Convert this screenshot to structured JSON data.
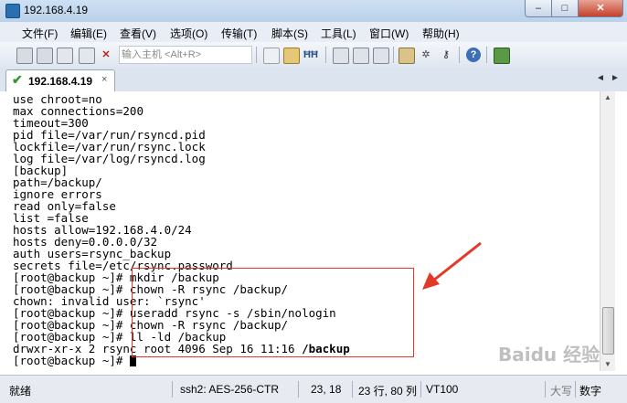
{
  "window": {
    "title": "192.168.4.19",
    "min": "–",
    "max": "□",
    "close": "✕"
  },
  "menubar": [
    "文件(F)",
    "编辑(E)",
    "查看(V)",
    "选项(O)",
    "传输(T)",
    "脚本(S)",
    "工具(L)",
    "窗口(W)",
    "帮助(H)"
  ],
  "toolbar": {
    "host_placeholder": "输入主机 <Alt+R>",
    "icons": [
      "connect-icon",
      "quick-connect-icon",
      "connect-tab-icon",
      "reconnect-icon",
      "disconnect-icon",
      "copy-icon",
      "paste-icon",
      "find-icon",
      "print-icon",
      "print-setup-icon",
      "sftp-icon",
      "session-options-icon",
      "global-options-icon",
      "key-icon",
      "help-icon",
      "app-icon"
    ]
  },
  "tab": {
    "label": "192.168.4.19",
    "close": "×"
  },
  "tab_nav": {
    "left": "◄",
    "right": "►"
  },
  "terminal": {
    "lines": [
      "use chroot=no",
      "max connections=200",
      "timeout=300",
      "pid file=/var/run/rsyncd.pid",
      "lockfile=/var/run/rsync.lock",
      "log file=/var/log/rsyncd.log",
      "[backup]",
      "path=/backup/",
      "ignore errors",
      "read only=false",
      "list =false",
      "hosts allow=192.168.4.0/24",
      "hosts deny=0.0.0.0/32",
      "auth users=rsync_backup",
      "secrets file=/etc/rsync.password",
      "[root@backup ~]# mkdir /backup",
      "[root@backup ~]# chown -R rsync /backup/",
      "chown: invalid user: `rsync'",
      "[root@backup ~]# useradd rsync -s /sbin/nologin",
      "[root@backup ~]# chown -R rsync /backup/",
      "[root@backup ~]# ll -ld /backup",
      "drwxr-xr-x 2 rsync root 4096 Sep 16 11:16 ",
      "[root@backup ~]# "
    ],
    "bold_tail": "/backup"
  },
  "scrollbar": {
    "up": "▲",
    "down": "▼"
  },
  "statusbar": {
    "ready": "就绪",
    "cipher": "ssh2: AES-256-CTR",
    "cursor": "23,  18",
    "rows_cols": "23 行, 80 列",
    "term": "VT100",
    "caps": "大写",
    "num": "数字"
  },
  "watermark": "Baidu 经验",
  "colors": {
    "annotation": "#e23a2a",
    "titlebar": "#c3d7ee"
  }
}
